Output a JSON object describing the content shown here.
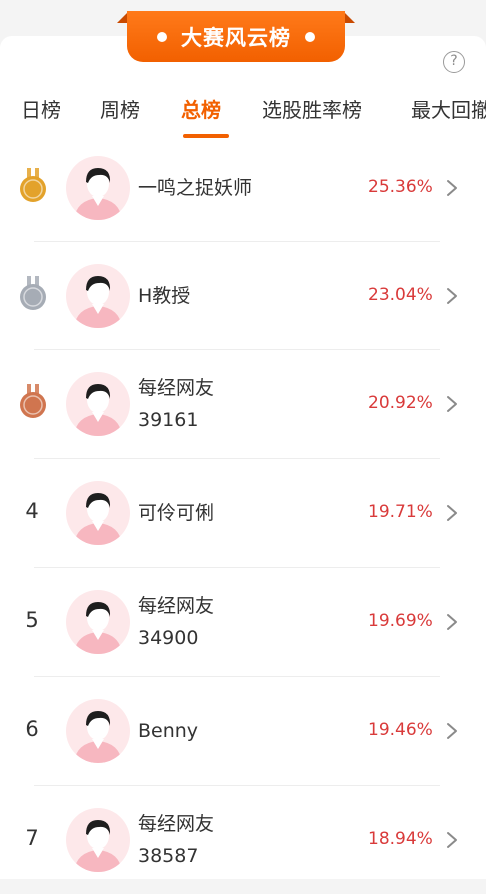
{
  "banner": {
    "title": "大赛风云榜"
  },
  "help_icon": "?",
  "tabs": [
    {
      "label": "日榜"
    },
    {
      "label": "周榜"
    },
    {
      "label": "总榜",
      "active": true
    },
    {
      "label": "选股胜率榜"
    },
    {
      "label": "最大回撤"
    }
  ],
  "colors": {
    "accent": "#f26000",
    "pct": "#d93a3a",
    "gold": "#e3a22b",
    "silver": "#a6acb5",
    "bronze": "#d0754f"
  },
  "rows": [
    {
      "rank": "1",
      "medal": "gold",
      "name_line1": "一鸣之捉妖师",
      "name_line2": "",
      "pct": "25.36%"
    },
    {
      "rank": "2",
      "medal": "silver",
      "name_line1": "H教授",
      "name_line2": "",
      "pct": "23.04%"
    },
    {
      "rank": "3",
      "medal": "bronze",
      "name_line1": "每经网友",
      "name_line2": "39161",
      "pct": "20.92%"
    },
    {
      "rank": "4",
      "medal": "",
      "name_line1": "可伶可俐",
      "name_line2": "",
      "pct": "19.71%"
    },
    {
      "rank": "5",
      "medal": "",
      "name_line1": "每经网友",
      "name_line2": "34900",
      "pct": "19.69%"
    },
    {
      "rank": "6",
      "medal": "",
      "name_line1": "Benny",
      "name_line2": "",
      "pct": "19.46%"
    },
    {
      "rank": "7",
      "medal": "",
      "name_line1": "每经网友",
      "name_line2": "38587",
      "pct": "18.94%"
    }
  ]
}
